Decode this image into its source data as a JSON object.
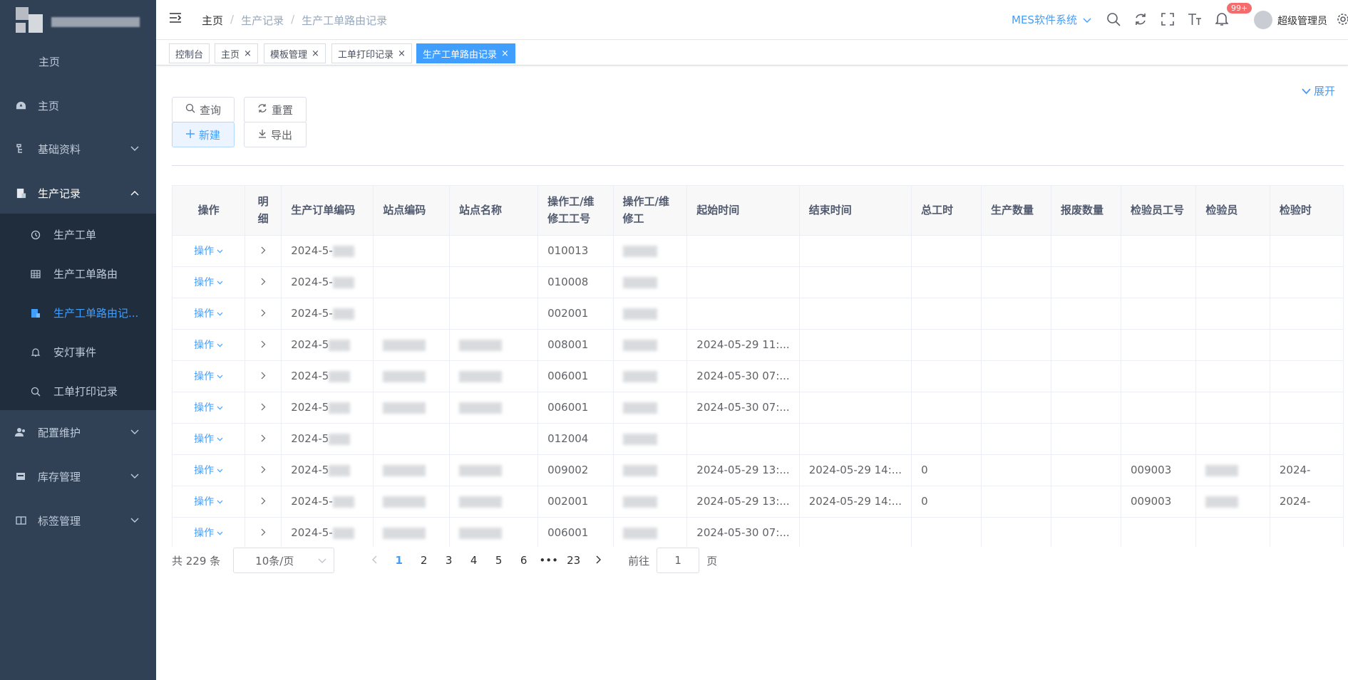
{
  "sidebar": {
    "top_item": "主页",
    "items": [
      {
        "label": "主页",
        "icon": "dashboard-icon"
      },
      {
        "label": "基础资料",
        "icon": "tree-icon"
      },
      {
        "label": "生产记录",
        "icon": "record-icon"
      },
      {
        "label": "配置维护",
        "icon": "users-icon"
      },
      {
        "label": "库存管理",
        "icon": "warehouse-icon"
      },
      {
        "label": "标签管理",
        "icon": "label-icon"
      }
    ],
    "sub_items": [
      {
        "label": "生产工单",
        "icon": "history-icon"
      },
      {
        "label": "生产工单路由",
        "icon": "table-icon"
      },
      {
        "label": "生产工单路由记...",
        "icon": "document-icon"
      },
      {
        "label": "安灯事件",
        "icon": "bell-icon"
      },
      {
        "label": "工单打印记录",
        "icon": "search-icon"
      }
    ]
  },
  "header": {
    "breadcrumb": [
      "主页",
      "生产记录",
      "生产工单路由记录"
    ],
    "breadcrumb_sep": "/",
    "system": "MES软件系统",
    "badge": "99+",
    "user": "超级管理员"
  },
  "tags": [
    {
      "label": "控制台",
      "closable": false
    },
    {
      "label": "主页",
      "closable": true
    },
    {
      "label": "模板管理",
      "closable": true
    },
    {
      "label": "工单打印记录",
      "closable": true
    },
    {
      "label": "生产工单路由记录",
      "closable": true,
      "active": true
    }
  ],
  "tag_close": "×",
  "toolbar": {
    "expand": "展开",
    "query": "查询",
    "reset": "重置",
    "create": "新建",
    "export": "导出"
  },
  "table": {
    "columns": [
      "操作",
      "明细",
      "生产订单编码",
      "站点编码",
      "站点名称",
      "操作工/维修工工号",
      "操作工/维修工",
      "起始时间",
      "结束时间",
      "总工时",
      "生产数量",
      "报废数量",
      "检验员工号",
      "检验员",
      "检验时"
    ],
    "op_label": "操作",
    "rows": [
      {
        "order": "2024-5-",
        "site_code": "",
        "site_name": "",
        "worker_no": "010013",
        "worker": "",
        "start": "",
        "end": "",
        "hours": "",
        "inspector_no": "",
        "check_time": ""
      },
      {
        "order": "2024-5-",
        "site_code": "",
        "site_name": "",
        "worker_no": "010008",
        "worker": "",
        "start": "",
        "end": "",
        "hours": "",
        "inspector_no": "",
        "check_time": ""
      },
      {
        "order": "2024-5-",
        "site_code": "",
        "site_name": "",
        "worker_no": "002001",
        "worker": "",
        "start": "",
        "end": "",
        "hours": "",
        "inspector_no": "",
        "check_time": ""
      },
      {
        "order": "2024-5",
        "site_code": "",
        "site_name": "",
        "worker_no": "008001",
        "worker": "",
        "start": "2024-05-29 11:...",
        "end": "",
        "hours": "",
        "inspector_no": "",
        "check_time": ""
      },
      {
        "order": "2024-5",
        "site_code": "",
        "site_name": "",
        "worker_no": "006001",
        "worker": "",
        "start": "2024-05-30 07:...",
        "end": "",
        "hours": "",
        "inspector_no": "",
        "check_time": ""
      },
      {
        "order": "2024-5",
        "site_code": "",
        "site_name": "",
        "worker_no": "006001",
        "worker": "",
        "start": "2024-05-30 07:...",
        "end": "",
        "hours": "",
        "inspector_no": "",
        "check_time": ""
      },
      {
        "order": "2024-5",
        "site_code": "",
        "site_name": "",
        "worker_no": "012004",
        "worker": "",
        "start": "",
        "end": "",
        "hours": "",
        "inspector_no": "",
        "check_time": ""
      },
      {
        "order": "2024-5",
        "site_code": "",
        "site_name": "",
        "worker_no": "009002",
        "worker": "",
        "start": "2024-05-29 13:...",
        "end": "2024-05-29 14:...",
        "hours": "0",
        "inspector_no": "009003",
        "check_time": "2024-"
      },
      {
        "order": "2024-5-",
        "site_code": "",
        "site_name": "",
        "worker_no": "002001",
        "worker": "",
        "start": "2024-05-29 13:...",
        "end": "2024-05-29 14:...",
        "hours": "0",
        "inspector_no": "009003",
        "check_time": "2024-"
      },
      {
        "order": "2024-5-",
        "site_code": "",
        "site_name": "",
        "worker_no": "006001",
        "worker": "",
        "start": "2024-05-30 07:...",
        "end": "",
        "hours": "",
        "inspector_no": "",
        "check_time": ""
      }
    ]
  },
  "pagination": {
    "total": "共 229 条",
    "page_size": "10条/页",
    "pages": [
      "1",
      "2",
      "3",
      "4",
      "5",
      "6"
    ],
    "ellipsis": "•••",
    "last_page": "23",
    "goto_label": "前往",
    "goto_value": "1",
    "page_suffix": "页"
  },
  "colors": {
    "accent": "#409eff",
    "sidebar": "#304156",
    "sidebar_sub": "#1f2d3d",
    "badge": "#f56c6c"
  }
}
